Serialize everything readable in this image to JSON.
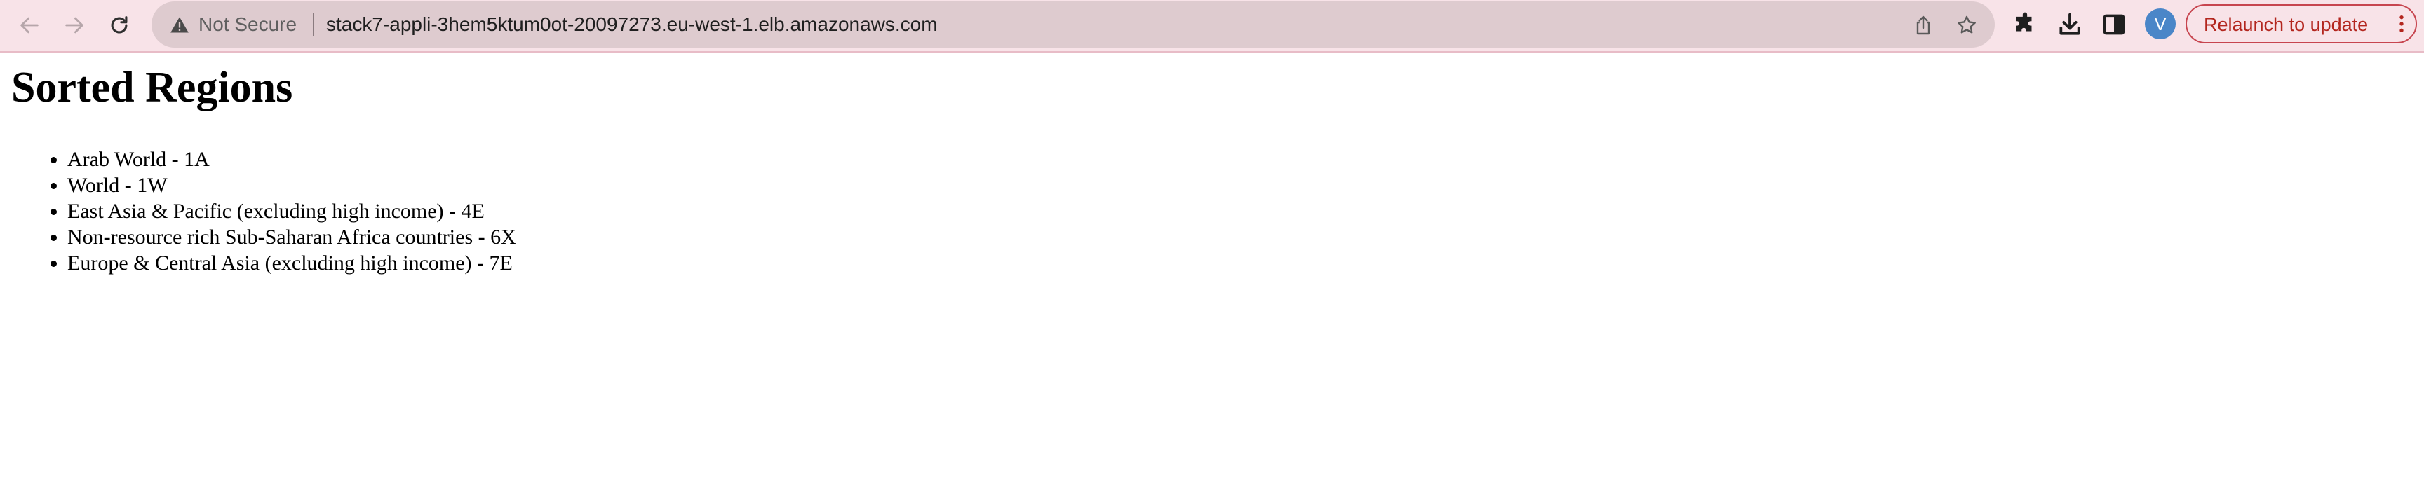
{
  "browser": {
    "security_label": "Not Secure",
    "url": "stack7-appli-3hem5ktum0ot-20097273.eu-west-1.elb.amazonaws.com",
    "profile_initial": "V",
    "relaunch_label": "Relaunch to update",
    "icons": [
      "back-arrow-icon",
      "forward-arrow-icon",
      "reload-icon",
      "warning-icon",
      "share-icon",
      "star-icon",
      "extensions-icon",
      "download-icon",
      "side-panel-icon",
      "kebab-menu-icon"
    ],
    "colors": {
      "toolbar": "#f8e3e8",
      "omnibox": "#decbcf",
      "relaunch_accent": "#b3261e",
      "avatar": "#4a86c8"
    }
  },
  "page": {
    "heading": "Sorted Regions",
    "regions": [
      "Arab World - 1A",
      "World - 1W",
      "East Asia & Pacific (excluding high income) - 4E",
      "Non-resource rich Sub-Saharan Africa countries - 6X",
      "Europe & Central Asia (excluding high income) - 7E"
    ]
  }
}
